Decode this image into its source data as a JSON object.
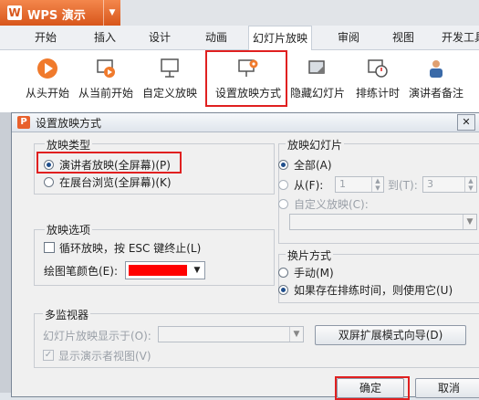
{
  "app": {
    "name": "WPS 演示",
    "logo": "W"
  },
  "tabs": [
    "开始",
    "插入",
    "设计",
    "动画",
    "幻灯片放映",
    "审阅",
    "视图",
    "开发工具"
  ],
  "ribbon": {
    "items": [
      {
        "label": "从头开始",
        "icon": "play-icon"
      },
      {
        "label": "从当前开始",
        "icon": "play-current-icon"
      },
      {
        "label": "自定义放映",
        "icon": "custom-show-icon"
      },
      {
        "label": "设置放映方式",
        "icon": "setup-show-icon"
      },
      {
        "label": "隐藏幻灯片",
        "icon": "hide-slide-icon"
      },
      {
        "label": "排练计时",
        "icon": "rehearse-timing-icon"
      },
      {
        "label": "演讲者备注",
        "icon": "speaker-notes-icon"
      }
    ]
  },
  "dialog": {
    "title": "设置放映方式",
    "close": "✕",
    "show_type": {
      "title": "放映类型",
      "option1": "演讲者放映(全屏幕)(P)",
      "option2": "在展台浏览(全屏幕)(K)"
    },
    "show_options": {
      "title": "放映选项",
      "loop": "循环放映，按 ESC 键终止(L)",
      "pen_color_label": "绘图笔颜色(E):",
      "pen_color": "#ff0000"
    },
    "slides": {
      "title": "放映幻灯片",
      "all": "全部(A)",
      "from": "从(F):",
      "from_value": "1",
      "to": "到(T):",
      "to_value": "3",
      "custom": "自定义放映(C):"
    },
    "advance": {
      "title": "换片方式",
      "manual": "手动(M)",
      "timing": "如果存在排练时间，则使用它(U)"
    },
    "monitors": {
      "title": "多监视器",
      "display_on": "幻灯片放映显示于(O):",
      "wizard_button": "双屏扩展模式向导(D)",
      "presenter_view": "显示演示者视图(V)"
    },
    "ok": "确定",
    "cancel": "取消"
  },
  "accent": "#e02020"
}
